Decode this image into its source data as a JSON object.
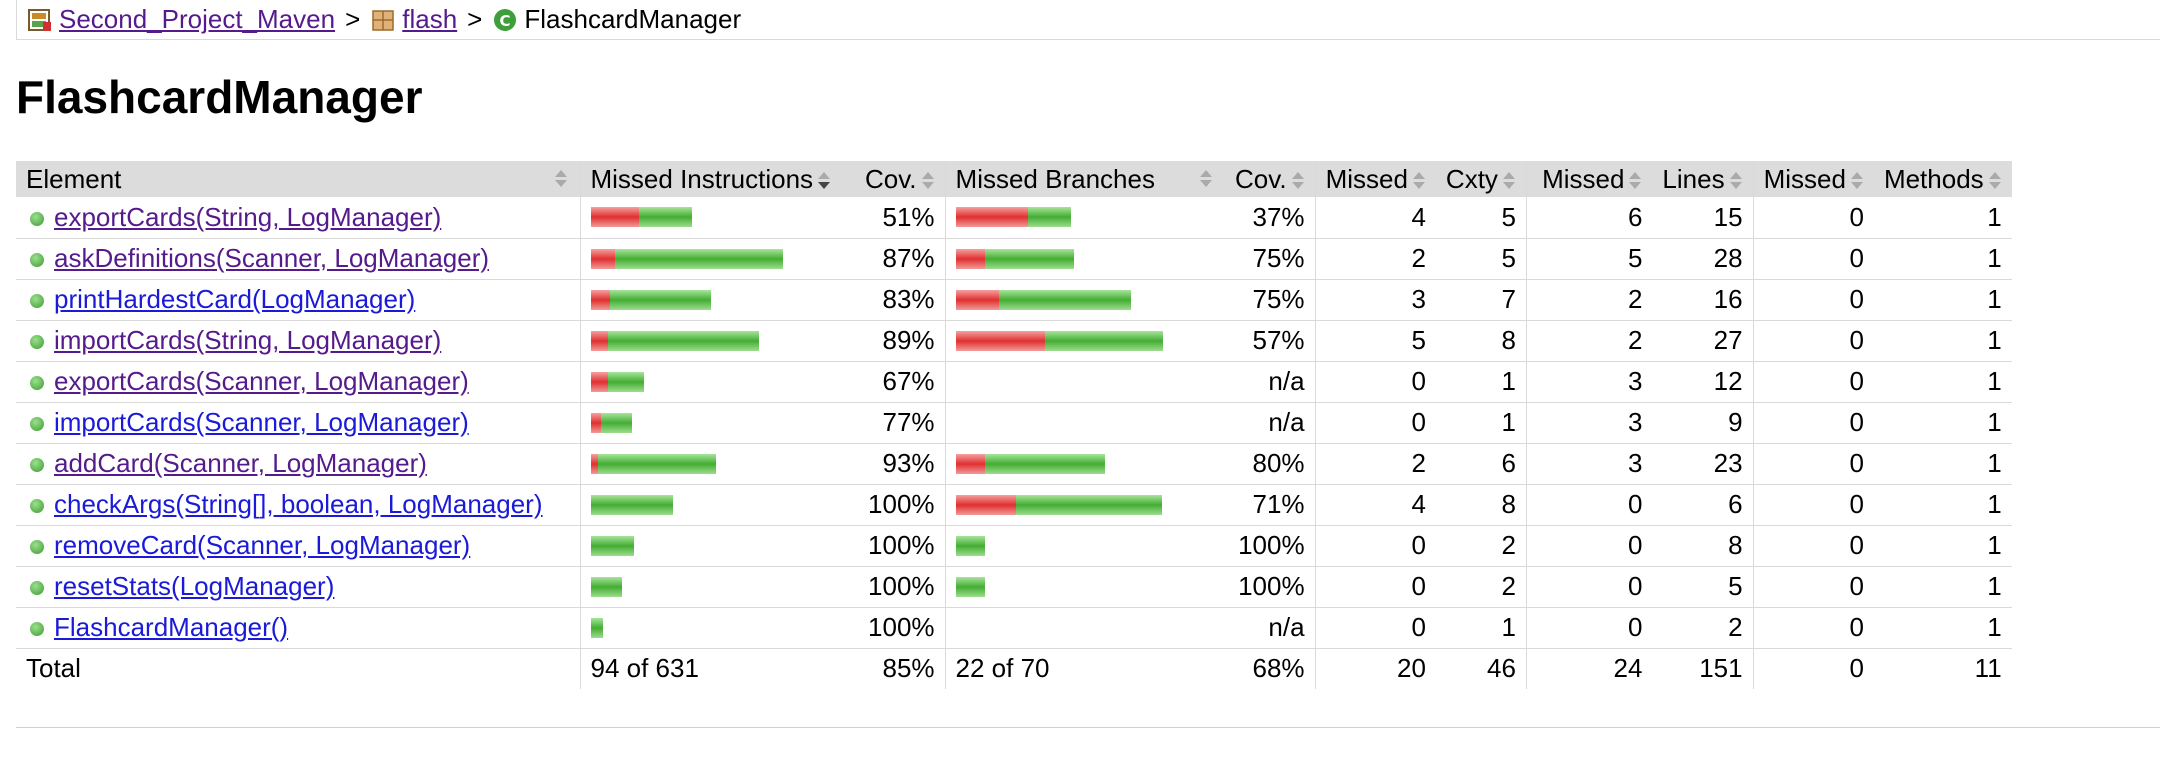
{
  "breadcrumb": {
    "project": "Second_Project_Maven",
    "package": "flash",
    "class": "FlashcardManager",
    "separator": ">"
  },
  "title": "FlashcardManager",
  "headers": {
    "element": "Element",
    "missed_instructions": "Missed Instructions",
    "cov1": "Cov.",
    "missed_branches": "Missed Branches",
    "cov2": "Cov.",
    "missed_cxty": "Missed",
    "cxty": "Cxty",
    "missed_lines": "Missed",
    "lines": "Lines",
    "missed_methods": "Missed",
    "methods": "Methods"
  },
  "rows": [
    {
      "name": "exportCards(String, LogManager)",
      "visited": true,
      "instr_cov": "51%",
      "instr_missed": 0.2,
      "instr_total": 0.42,
      "br_cov": "37%",
      "br_missed": 0.3,
      "br_total": 0.48,
      "missed_cxty": "4",
      "cxty": "5",
      "missed_lines": "6",
      "lines": "15",
      "missed_methods": "0",
      "methods": "1"
    },
    {
      "name": "askDefinitions(Scanner, LogManager)",
      "visited": true,
      "instr_cov": "87%",
      "instr_missed": 0.1,
      "instr_total": 0.8,
      "br_cov": "75%",
      "br_missed": 0.12,
      "br_total": 0.49,
      "missed_cxty": "2",
      "cxty": "5",
      "missed_lines": "5",
      "lines": "28",
      "missed_methods": "0",
      "methods": "1"
    },
    {
      "name": "printHardestCard(LogManager)",
      "visited": false,
      "instr_cov": "83%",
      "instr_missed": 0.08,
      "instr_total": 0.5,
      "br_cov": "75%",
      "br_missed": 0.18,
      "br_total": 0.73,
      "missed_cxty": "3",
      "cxty": "7",
      "missed_lines": "2",
      "lines": "16",
      "missed_methods": "0",
      "methods": "1"
    },
    {
      "name": "importCards(String, LogManager)",
      "visited": true,
      "instr_cov": "89%",
      "instr_missed": 0.07,
      "instr_total": 0.7,
      "br_cov": "57%",
      "br_missed": 0.37,
      "br_total": 0.86,
      "missed_cxty": "5",
      "cxty": "8",
      "missed_lines": "2",
      "lines": "27",
      "missed_methods": "0",
      "methods": "1"
    },
    {
      "name": "exportCards(Scanner, LogManager)",
      "visited": true,
      "instr_cov": "67%",
      "instr_missed": 0.07,
      "instr_total": 0.22,
      "br_cov": "n/a",
      "br_missed": 0,
      "br_total": 0,
      "missed_cxty": "0",
      "cxty": "1",
      "missed_lines": "3",
      "lines": "12",
      "missed_methods": "0",
      "methods": "1"
    },
    {
      "name": "importCards(Scanner, LogManager)",
      "visited": false,
      "instr_cov": "77%",
      "instr_missed": 0.04,
      "instr_total": 0.17,
      "br_cov": "n/a",
      "br_missed": 0,
      "br_total": 0,
      "missed_cxty": "0",
      "cxty": "1",
      "missed_lines": "3",
      "lines": "9",
      "missed_methods": "0",
      "methods": "1"
    },
    {
      "name": "addCard(Scanner, LogManager)",
      "visited": true,
      "instr_cov": "93%",
      "instr_missed": 0.03,
      "instr_total": 0.52,
      "br_cov": "80%",
      "br_missed": 0.12,
      "br_total": 0.62,
      "missed_cxty": "2",
      "cxty": "6",
      "missed_lines": "3",
      "lines": "23",
      "missed_methods": "0",
      "methods": "1"
    },
    {
      "name": "checkArgs(String[], boolean, LogManager)",
      "visited": false,
      "instr_cov": "100%",
      "instr_missed": 0,
      "instr_total": 0.34,
      "br_cov": "71%",
      "br_missed": 0.25,
      "br_total": 0.86,
      "missed_cxty": "4",
      "cxty": "8",
      "missed_lines": "0",
      "lines": "6",
      "missed_methods": "0",
      "methods": "1"
    },
    {
      "name": "removeCard(Scanner, LogManager)",
      "visited": false,
      "instr_cov": "100%",
      "instr_missed": 0,
      "instr_total": 0.18,
      "br_cov": "100%",
      "br_missed": 0,
      "br_total": 0.12,
      "missed_cxty": "0",
      "cxty": "2",
      "missed_lines": "0",
      "lines": "8",
      "missed_methods": "0",
      "methods": "1"
    },
    {
      "name": "resetStats(LogManager)",
      "visited": false,
      "instr_cov": "100%",
      "instr_missed": 0,
      "instr_total": 0.13,
      "br_cov": "100%",
      "br_missed": 0,
      "br_total": 0.12,
      "missed_cxty": "0",
      "cxty": "2",
      "missed_lines": "0",
      "lines": "5",
      "missed_methods": "0",
      "methods": "1"
    },
    {
      "name": "FlashcardManager()",
      "visited": false,
      "instr_cov": "100%",
      "instr_missed": 0,
      "instr_total": 0.05,
      "br_cov": "n/a",
      "br_missed": 0,
      "br_total": 0,
      "missed_cxty": "0",
      "cxty": "1",
      "missed_lines": "0",
      "lines": "2",
      "missed_methods": "0",
      "methods": "1"
    }
  ],
  "total": {
    "label": "Total",
    "instructions": "94 of 631",
    "instr_cov": "85%",
    "branches": "22 of 70",
    "br_cov": "68%",
    "missed_cxty": "20",
    "cxty": "46",
    "missed_lines": "24",
    "lines": "151",
    "missed_methods": "0",
    "methods": "11"
  }
}
